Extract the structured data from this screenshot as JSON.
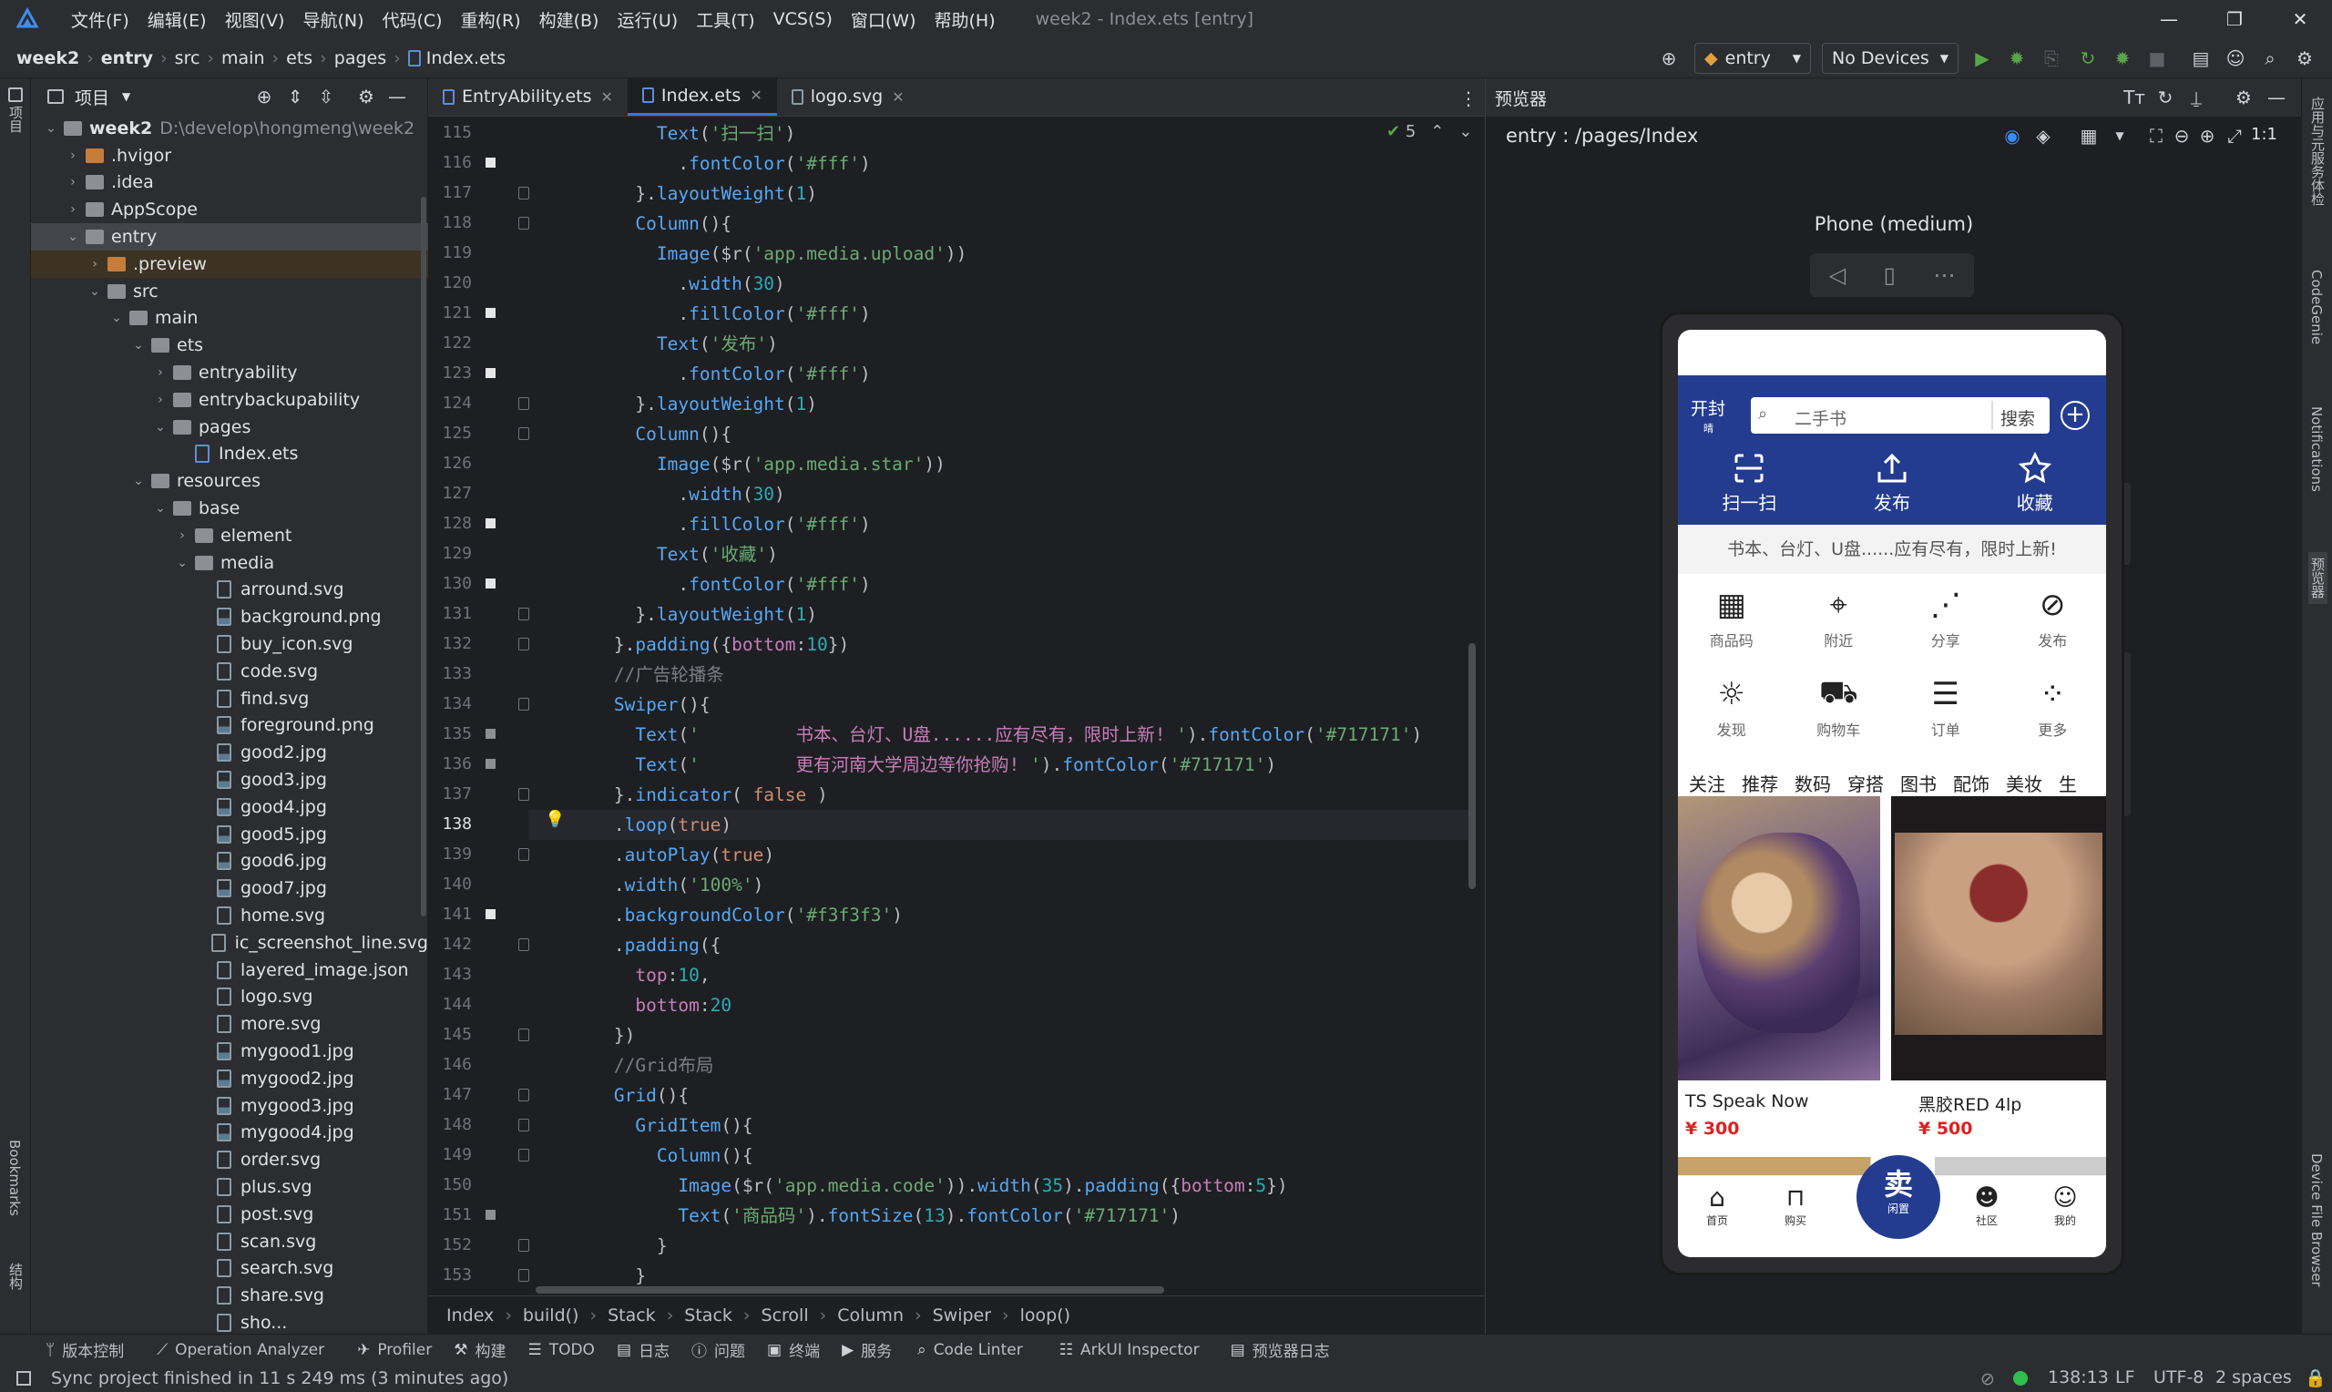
{
  "menubar": {
    "items": [
      "文件(F)",
      "编辑(E)",
      "视图(V)",
      "导航(N)",
      "代码(C)",
      "重构(R)",
      "构建(B)",
      "运行(U)",
      "工具(T)",
      "VCS(S)",
      "窗口(W)",
      "帮助(H)"
    ],
    "title": "week2 - Index.ets [entry]"
  },
  "breadcrumb": [
    "week2",
    "entry",
    "src",
    "main",
    "ets",
    "pages",
    "Index.ets"
  ],
  "toolbar": {
    "config": "entry",
    "device": "No Devices"
  },
  "project": {
    "title": "项目",
    "root": "week2",
    "root_path": "D:\\develop\\hongmeng\\week2",
    "items": [
      ".hvigor",
      ".idea",
      "AppScope",
      "entry",
      ".preview",
      "src",
      "main",
      "ets",
      "entryability",
      "entrybackupability",
      "pages",
      "Index.ets",
      "resources",
      "base",
      "element",
      "media",
      "arround.svg",
      "background.png",
      "buy_icon.svg",
      "code.svg",
      "find.svg",
      "foreground.png",
      "good2.jpg",
      "good3.jpg",
      "good4.jpg",
      "good5.jpg",
      "good6.jpg",
      "good7.jpg",
      "home.svg",
      "ic_screenshot_line.svg",
      "layered_image.json",
      "logo.svg",
      "more.svg",
      "mygood1.jpg",
      "mygood2.jpg",
      "mygood3.jpg",
      "mygood4.jpg",
      "order.svg",
      "plus.svg",
      "post.svg",
      "scan.svg",
      "search.svg",
      "share.svg",
      "sho..."
    ]
  },
  "tabs": [
    "EntryAbility.ets",
    "Index.ets",
    "logo.svg"
  ],
  "editor": {
    "check_count": "5",
    "lines": [
      "115",
      "116",
      "117",
      "118",
      "119",
      "120",
      "121",
      "122",
      "123",
      "124",
      "125",
      "126",
      "127",
      "128",
      "129",
      "130",
      "131",
      "132",
      "133",
      "134",
      "135",
      "136",
      "137",
      "138",
      "139",
      "140",
      "141",
      "142",
      "143",
      "144",
      "145",
      "146",
      "147",
      "148",
      "149",
      "150",
      "151",
      "152",
      "153"
    ]
  },
  "code_breadcrumb": [
    "Index",
    "build()",
    "Stack",
    "Stack",
    "Scroll",
    "Column",
    "Swiper",
    "loop()"
  ],
  "preview": {
    "title": "预览器",
    "route": "entry : /pages/Index",
    "device": "Phone (medium)"
  },
  "app": {
    "city": "开封",
    "weather": "晴",
    "search_placeholder": "二手书",
    "search_btn": "搜索",
    "actions": [
      "扫一扫",
      "发布",
      "收藏"
    ],
    "banner": "书本、台灯、U盘......应有尽有，限时上新!",
    "categories": [
      "商品码",
      "附近",
      "分享",
      "发布",
      "发现",
      "购物车",
      "订单",
      "更多"
    ],
    "tabs": [
      "关注",
      "推荐",
      "数码",
      "穿搭",
      "图书",
      "配饰",
      "美妆",
      "生"
    ],
    "goods": [
      {
        "name": "TS Speak Now",
        "price": "¥ 300"
      },
      {
        "name": "黑胶RED 4lp",
        "price": "¥ 500"
      }
    ],
    "nav": [
      "首页",
      "购买",
      "卖",
      "闲置",
      "社区",
      "我的"
    ]
  },
  "bottombar": [
    "版本控制",
    "Operation Analyzer",
    "Profiler",
    "构建",
    "TODO",
    "日志",
    "问题",
    "终端",
    "服务",
    "Code Linter",
    "ArkUI Inspector",
    "预览器日志"
  ],
  "status": {
    "message": "Sync project finished in 11 s 249 ms (3 minutes ago)",
    "pos": "138:13",
    "eol": "LF",
    "enc": "UTF-8",
    "indent": "2 spaces"
  },
  "sidestrip": {
    "left": [
      "项目",
      "Bookmarks",
      "结构"
    ],
    "right": [
      "应用与元服务体检",
      "CodeGenie",
      "Notifications",
      "预览器",
      "Device File Browser"
    ]
  },
  "colors": {
    "accent": "#3574f0",
    "app_blue": "#243c90",
    "price_red": "#e02020"
  }
}
